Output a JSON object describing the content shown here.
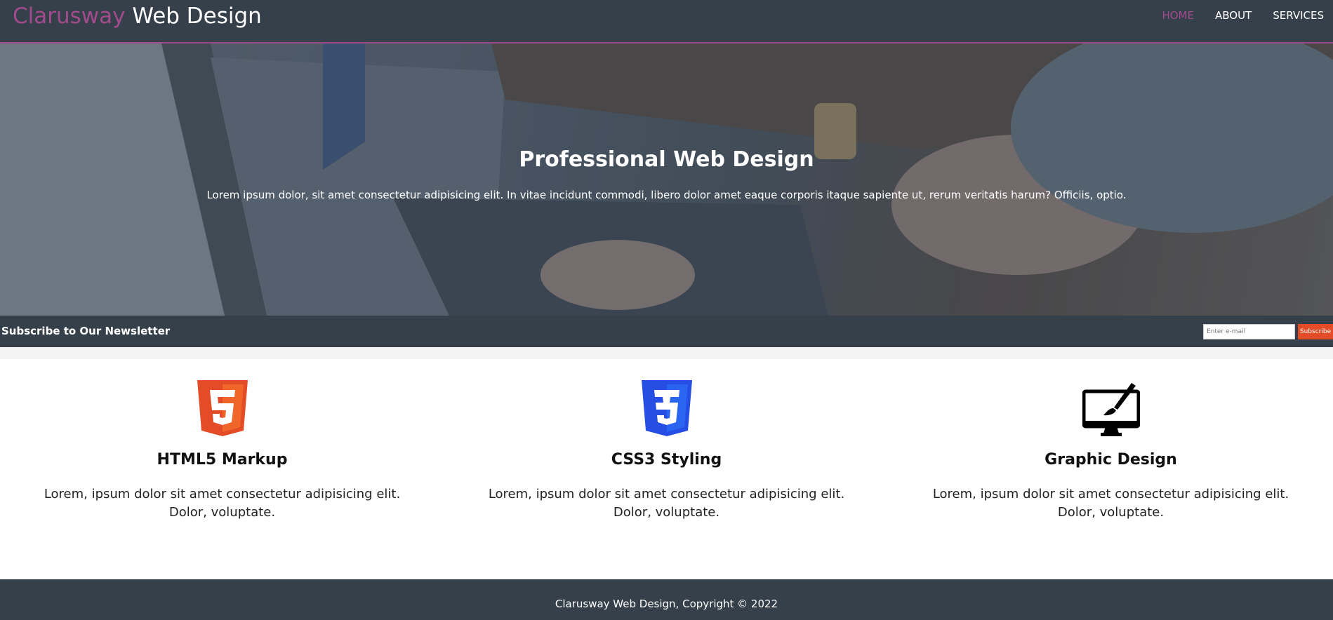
{
  "header": {
    "logo_accent": "Clarusway",
    "logo_rest": " Web Design",
    "nav": [
      {
        "label": "HOME",
        "active": true
      },
      {
        "label": "ABOUT",
        "active": false
      },
      {
        "label": "SERVICES",
        "active": false
      }
    ]
  },
  "hero": {
    "title": "Professional Web Design",
    "text": "Lorem ipsum dolor, sit amet consectetur adipisicing elit. In vitae incidunt commodi, libero dolor amet eaque corporis itaque sapiente ut, rerum veritatis harum? Officiis, optio."
  },
  "newsletter": {
    "title": "Subscribe to Our Newsletter",
    "input_placeholder": "Enter e-mail",
    "button_label": "Subscribe"
  },
  "features": [
    {
      "icon": "html5-icon",
      "title": "HTML5 Markup",
      "text": "Lorem, ipsum dolor sit amet consectetur adipisicing elit. Dolor, voluptate."
    },
    {
      "icon": "css3-icon",
      "title": "CSS3 Styling",
      "text": "Lorem, ipsum dolor sit amet consectetur adipisicing elit. Dolor, voluptate."
    },
    {
      "icon": "monitor-brush-icon",
      "title": "Graphic Design",
      "text": "Lorem, ipsum dolor sit amet consectetur adipisicing elit. Dolor, voluptate."
    }
  ],
  "footer": {
    "copyright": "Clarusway Web Design, Copyright © 2022"
  },
  "colors": {
    "dark": "#35404b",
    "accent": "#a24b8c",
    "html5": "#e34c26",
    "css3": "#264de4"
  }
}
